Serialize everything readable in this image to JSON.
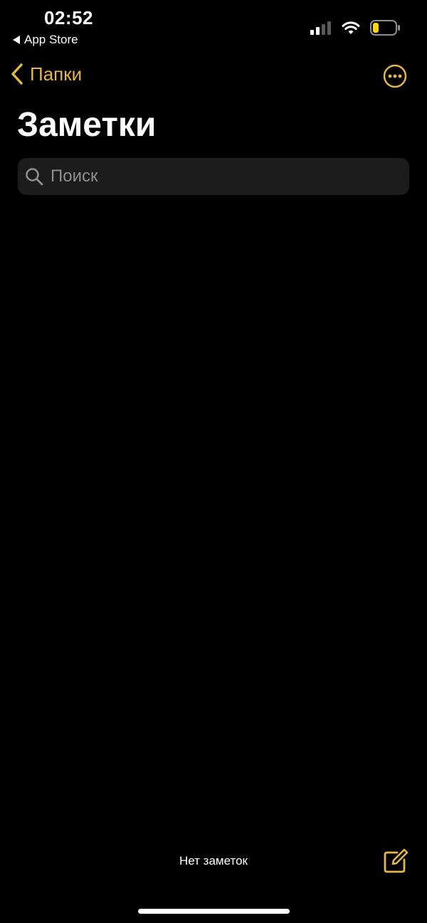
{
  "status_bar": {
    "time": "02:52",
    "back_app": "App Store",
    "icons": [
      "cellular-signal-icon",
      "wifi-icon",
      "battery-icon"
    ],
    "battery_level": 0.25,
    "battery_color": "#ffd60a"
  },
  "nav": {
    "back_label": "Папки",
    "more_icon": "ellipsis-circle-icon",
    "accent_color": "#e5b64a"
  },
  "page": {
    "title": "Заметки"
  },
  "search": {
    "placeholder": "Поиск",
    "value": ""
  },
  "footer": {
    "status": "Нет заметок",
    "compose_icon": "compose-icon"
  }
}
